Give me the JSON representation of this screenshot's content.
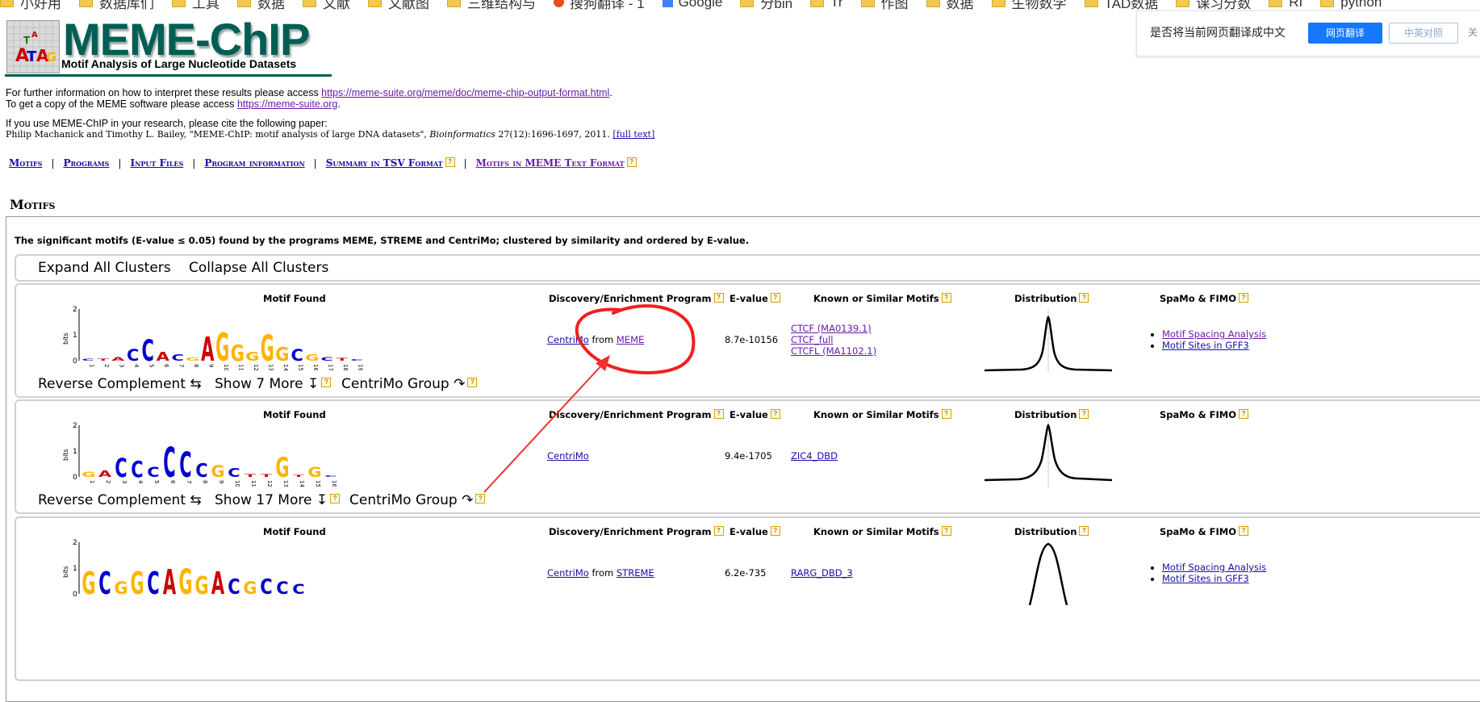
{
  "browser": {
    "bookmarks": [
      {
        "label": "小好用",
        "icon": "folder-icon"
      },
      {
        "label": "数据库们",
        "icon": "folder-icon"
      },
      {
        "label": "工具",
        "icon": "folder-icon"
      },
      {
        "label": "数据",
        "icon": "folder-icon"
      },
      {
        "label": "文献",
        "icon": "folder-icon"
      },
      {
        "label": "文献图",
        "icon": "folder-icon"
      },
      {
        "label": "三维结构与",
        "icon": "folder-icon"
      },
      {
        "label": "搜狗翻译 - 1",
        "icon": "sogou-icon"
      },
      {
        "label": "Google",
        "icon": "google-icon"
      },
      {
        "label": "分bin",
        "icon": "folder-icon"
      },
      {
        "label": "Tr",
        "icon": "folder-icon"
      },
      {
        "label": "作图",
        "icon": "folder-icon"
      },
      {
        "label": "数据",
        "icon": "folder-icon"
      },
      {
        "label": "生物数学",
        "icon": "folder-icon"
      },
      {
        "label": "TAD数据",
        "icon": "folder-icon"
      },
      {
        "label": "课习分数",
        "icon": "folder-icon"
      },
      {
        "label": "RI",
        "icon": "folder-icon"
      },
      {
        "label": "python",
        "icon": "folder-icon"
      }
    ],
    "translate_prompt": {
      "question": "是否将当前网页翻译成中文",
      "translate_button": "网页翻译",
      "bilingual_button": "中英对照",
      "close": "关"
    }
  },
  "header": {
    "title": "MEME-ChIP",
    "subtitle": "Motif Analysis of Large Nucleotide Datasets"
  },
  "intro": {
    "line1_prefix": "For further information on how to interpret these results please access ",
    "line1_link": "https://meme-suite.org/meme/doc/meme-chip-output-format.html",
    "line1_suffix": ".",
    "line2_prefix": "To get a copy of the MEME software please access ",
    "line2_link": "https://meme-suite.org",
    "line2_suffix": ".",
    "cite_intro": "If you use MEME-ChIP in your research, please cite the following paper:",
    "cite_authors": "Philip Machanick and Timothy L. Bailey, \"MEME-ChIP: motif analysis of large DNA datasets\", ",
    "cite_journal": "Bioinformatics",
    "cite_volume": " 27",
    "cite_pages": "(12):1696-1697, 2011. ",
    "cite_link": "[full text]"
  },
  "nav": {
    "motifs": "Motifs",
    "programs": "Programs",
    "input_files": "Input Files",
    "program_information": "Program information",
    "summary_tsv": "Summary in TSV Format",
    "motifs_meme_text": "Motifs in MEME Text Format",
    "separator": "|",
    "help": "?"
  },
  "motifs_section": {
    "heading": "Motifs",
    "description": "The significant motifs (E-value ≤ 0.05) found by the programs MEME, STREME and CentriMo; clustered by similarity and ordered by E-value.",
    "expand_all": "Expand All Clusters",
    "collapse_all": "Collapse All Clusters"
  },
  "columns": {
    "motif_found": "Motif Found",
    "program": "Discovery/Enrichment Program",
    "evalue": "E-value",
    "known": "Known or Similar Motifs",
    "distribution": "Distribution",
    "spamo": "SpaMo & FIMO"
  },
  "controls": {
    "reverse_complement": "Reverse Complement ⇆",
    "centrimo_group": "CentriMo Group ↷"
  },
  "logo_axis": {
    "label": "bits",
    "ticks": [
      "2",
      "1",
      "0"
    ]
  },
  "motif_rows": [
    {
      "program_main": "CentriMo",
      "program_from": " from ",
      "program_source": "MEME",
      "evalue": "8.7e-10156",
      "known": [
        "CTCF (MA0139.1)",
        "CTCF_full",
        "CTCFL (MA1102.1)"
      ],
      "show_more": "Show 7 More ↧",
      "spamo": [
        "Motif Spacing Analysis",
        "Motif Sites in GFF3"
      ],
      "positions": [
        "1",
        "2",
        "3",
        "4",
        "5",
        "6",
        "7",
        "8",
        "9",
        "10",
        "11",
        "12",
        "13",
        "14",
        "15",
        "16",
        "17",
        "18",
        "19"
      ],
      "letters": [
        {
          "ch": "C",
          "color": "#0000cc",
          "h": 0.08
        },
        {
          "ch": "T",
          "color": "#cc0000",
          "h": 0.08
        },
        {
          "ch": "A",
          "color": "#cc0000",
          "h": 0.15
        },
        {
          "ch": "C",
          "color": "#0000cc",
          "h": 0.45
        },
        {
          "ch": "C",
          "color": "#0000cc",
          "h": 0.85
        },
        {
          "ch": "A",
          "color": "#cc0000",
          "h": 0.35
        },
        {
          "ch": "C",
          "color": "#0000cc",
          "h": 0.25
        },
        {
          "ch": "G",
          "color": "#ffb300",
          "h": 0.12
        },
        {
          "ch": "A",
          "color": "#cc0000",
          "h": 0.95
        },
        {
          "ch": "G",
          "color": "#ffb300",
          "h": 1.1
        },
        {
          "ch": "G",
          "color": "#ffb300",
          "h": 0.65
        },
        {
          "ch": "G",
          "color": "#ffb300",
          "h": 0.35
        },
        {
          "ch": "G",
          "color": "#ffb300",
          "h": 1.05
        },
        {
          "ch": "G",
          "color": "#ffb300",
          "h": 0.55
        },
        {
          "ch": "C",
          "color": "#0000cc",
          "h": 0.45
        },
        {
          "ch": "G",
          "color": "#ffb300",
          "h": 0.25
        },
        {
          "ch": "C",
          "color": "#0000cc",
          "h": 0.15
        },
        {
          "ch": "T",
          "color": "#cc0000",
          "h": 0.1
        },
        {
          "ch": "C",
          "color": "#0000cc",
          "h": 0.07
        }
      ]
    },
    {
      "program_main": "CentriMo",
      "program_from": "",
      "program_source": "",
      "evalue": "9.4e-1705",
      "known": [
        "ZIC4_DBD"
      ],
      "show_more": "Show 17 More ↧",
      "spamo": [],
      "positions": [
        "1",
        "2",
        "3",
        "4",
        "5",
        "6",
        "7",
        "8",
        "9",
        "10",
        "11",
        "12",
        "13",
        "14",
        "15",
        "16"
      ],
      "letters": [
        {
          "ch": "G",
          "color": "#ffb300",
          "h": 0.2
        },
        {
          "ch": "A",
          "color": "#cc0000",
          "h": 0.25
        },
        {
          "ch": "C",
          "color": "#0000cc",
          "h": 0.75
        },
        {
          "ch": "C",
          "color": "#0000cc",
          "h": 0.65
        },
        {
          "ch": "C",
          "color": "#0000cc",
          "h": 0.4
        },
        {
          "ch": "C",
          "color": "#0000cc",
          "h": 1.2
        },
        {
          "ch": "C",
          "color": "#0000cc",
          "h": 1.0
        },
        {
          "ch": "C",
          "color": "#0000cc",
          "h": 0.55
        },
        {
          "ch": "G",
          "color": "#ffb300",
          "h": 0.45
        },
        {
          "ch": "C",
          "color": "#0000cc",
          "h": 0.35
        },
        {
          "ch": "T",
          "color": "#cc0000",
          "h": 0.1
        },
        {
          "ch": "T",
          "color": "#cc0000",
          "h": 0.1
        },
        {
          "ch": "G",
          "color": "#ffb300",
          "h": 0.8
        },
        {
          "ch": "T",
          "color": "#cc0000",
          "h": 0.08
        },
        {
          "ch": "G",
          "color": "#ffb300",
          "h": 0.4
        },
        {
          "ch": "C",
          "color": "#0000cc",
          "h": 0.05
        }
      ]
    },
    {
      "program_main": "CentriMo",
      "program_from": " from ",
      "program_source": "STREME",
      "evalue": "6.2e-735",
      "known": [
        "RARG_DBD_3"
      ],
      "show_more": "",
      "spamo": [
        "Motif Spacing Analysis",
        "Motif Sites in GFF3"
      ],
      "positions": [],
      "letters": [
        {
          "ch": "G",
          "color": "#ffb300",
          "h": 0.9
        },
        {
          "ch": "C",
          "color": "#0000cc",
          "h": 0.9
        },
        {
          "ch": "G",
          "color": "#ffb300",
          "h": 0.5
        },
        {
          "ch": "G",
          "color": "#ffb300",
          "h": 0.9
        },
        {
          "ch": "C",
          "color": "#0000cc",
          "h": 0.9
        },
        {
          "ch": "A",
          "color": "#cc0000",
          "h": 1.0
        },
        {
          "ch": "G",
          "color": "#ffb300",
          "h": 1.0
        },
        {
          "ch": "G",
          "color": "#ffb300",
          "h": 0.7
        },
        {
          "ch": "A",
          "color": "#cc0000",
          "h": 0.9
        },
        {
          "ch": "C",
          "color": "#0000cc",
          "h": 0.6
        },
        {
          "ch": "G",
          "color": "#ffb300",
          "h": 0.5
        },
        {
          "ch": "C",
          "color": "#0000cc",
          "h": 0.6
        },
        {
          "ch": "C",
          "color": "#0000cc",
          "h": 0.5
        },
        {
          "ch": "C",
          "color": "#0000cc",
          "h": 0.4
        }
      ]
    }
  ]
}
